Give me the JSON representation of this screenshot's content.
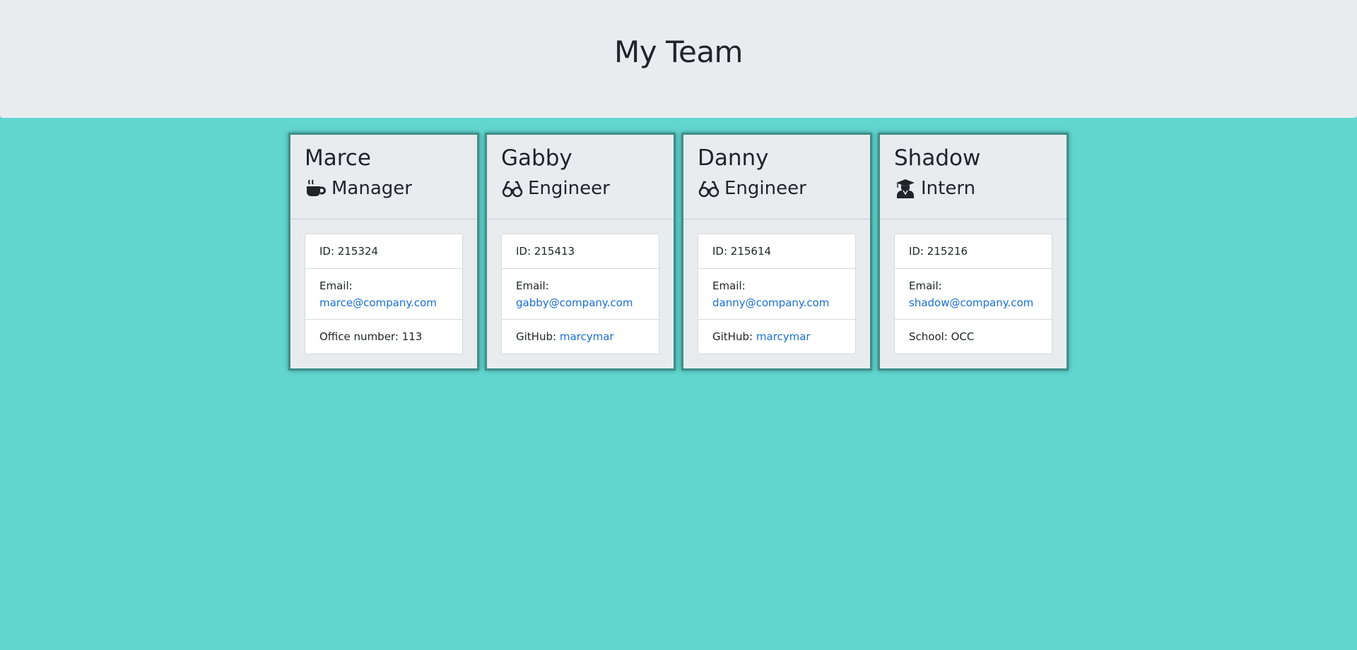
{
  "header": {
    "title": "My Team"
  },
  "colors": {
    "background": "#61d6cf",
    "panel": "#e9ecef",
    "link": "#1a6fd6",
    "card_border": "#3f8f8a"
  },
  "team": [
    {
      "name": "Marce",
      "role": "Manager",
      "icon": "coffee-mug-icon",
      "id_text": "ID: 215324",
      "email_label": "Email:",
      "email": "marce@company.com",
      "extra_label": "Office number: 113",
      "extra_link": ""
    },
    {
      "name": "Gabby",
      "role": "Engineer",
      "icon": "glasses-icon",
      "id_text": "ID: 215413",
      "email_label": "Email:",
      "email": "gabby@company.com",
      "extra_label": "GitHub:",
      "extra_link": "marcymar"
    },
    {
      "name": "Danny",
      "role": "Engineer",
      "icon": "glasses-icon",
      "id_text": "ID: 215614",
      "email_label": "Email:",
      "email": "danny@company.com",
      "extra_label": "GitHub:",
      "extra_link": "marcymar"
    },
    {
      "name": "Shadow",
      "role": "Intern",
      "icon": "graduate-icon",
      "id_text": "ID: 215216",
      "email_label": "Email:",
      "email": "shadow@company.com",
      "extra_label": "School: OCC",
      "extra_link": ""
    }
  ]
}
